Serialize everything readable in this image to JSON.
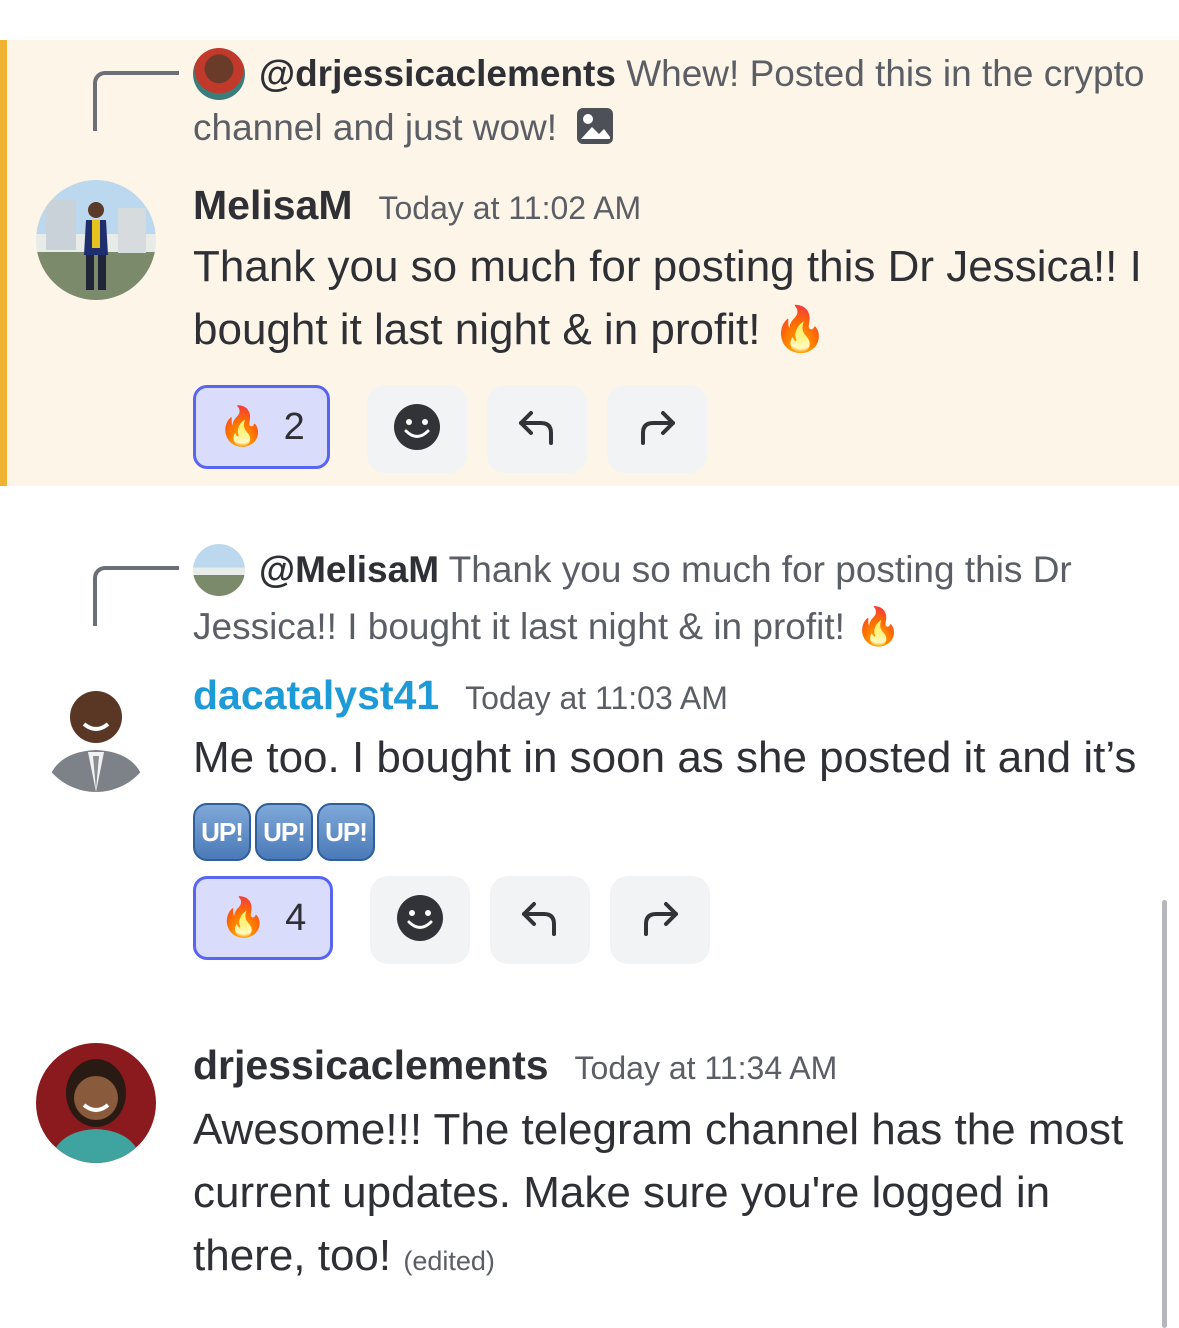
{
  "messages": [
    {
      "reply": {
        "user": "@drjessicaclements",
        "text": "Whew! Posted this in the crypto channel and just wow!",
        "attachment_icon": "image-icon"
      },
      "author": "MelisaM",
      "author_color": "#2e3035",
      "timestamp": "Today at 11:02 AM",
      "text": "Thank you so much for posting this Dr Jessica!! I bought it last night & in profit!",
      "emoji": "🔥",
      "reaction": {
        "emoji": "🔥",
        "count": "2"
      },
      "highlighted": true
    },
    {
      "reply": {
        "user": "@MelisaM",
        "text": "Thank you so much for posting this Dr Jessica!! I bought it last night & in profit!",
        "emoji": "🔥"
      },
      "author": "dacatalyst41",
      "author_color": "#1e9ad6",
      "timestamp": "Today at 11:03 AM",
      "text": "Me too. I bought in soon as she posted it and it’s",
      "badges": [
        "UP!",
        "UP!",
        "UP!"
      ],
      "reaction": {
        "emoji": "🔥",
        "count": "4"
      }
    },
    {
      "author": "drjessicaclements",
      "author_color": "#2e3035",
      "timestamp": "Today at 11:34 AM",
      "text": "Awesome!!! The telegram channel has the most current updates. Make sure you're logged in there, too!",
      "edited": "(edited)"
    }
  ],
  "action_icons": [
    "add-reaction-icon",
    "reply-icon",
    "forward-icon"
  ],
  "colors": {
    "accent": "#5865f2",
    "highlight": "#fdf6e8",
    "highlight_bar": "#f0b232"
  }
}
